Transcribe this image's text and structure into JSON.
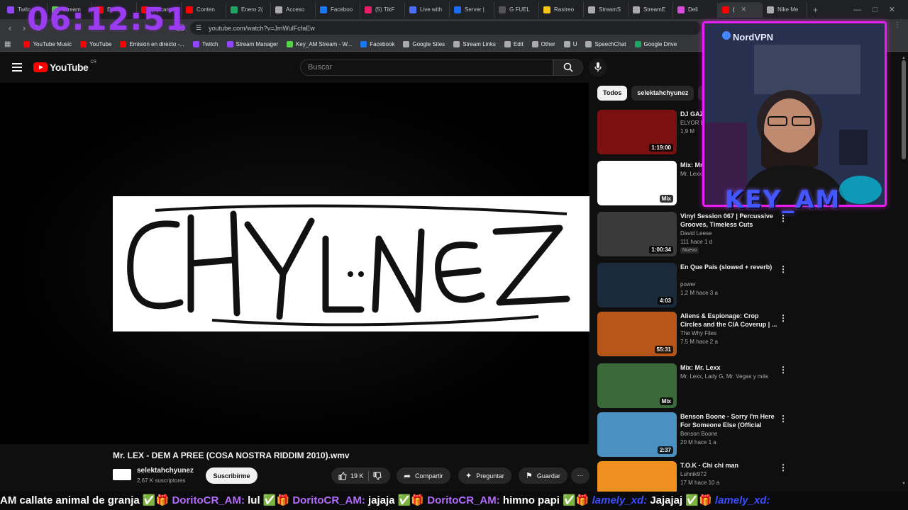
{
  "clock": "06:12:51",
  "browser": {
    "tabs": [
      {
        "label": "Twitc",
        "color": "#9146ff"
      },
      {
        "label": "Stream",
        "color": "#54d24a"
      },
      {
        "label": "Emis",
        "color": "#ff0000"
      },
      {
        "label": "(3) carg",
        "color": "#ff0000"
      },
      {
        "label": "Conten",
        "color": "#ff0000"
      },
      {
        "label": "Enero 2(",
        "color": "#1fa463"
      },
      {
        "label": "Acceso",
        "color": "#aaaaaa"
      },
      {
        "label": "Faceboo",
        "color": "#1877f2"
      },
      {
        "label": "(5) TikF",
        "color": "#e91e63"
      },
      {
        "label": "Live with",
        "color": "#4a6cf7"
      },
      {
        "label": "Server |",
        "color": "#1b6ef3"
      },
      {
        "label": "G FUEL",
        "color": "#555555"
      },
      {
        "label": "Rastreo",
        "color": "#f5c518"
      },
      {
        "label": "StreamS",
        "color": "#aaaaaa"
      },
      {
        "label": "StreamE",
        "color": "#aaaaaa"
      },
      {
        "label": "Deli",
        "color": "#d64fd8"
      },
      {
        "label": "(",
        "color": "#ff0000"
      },
      {
        "label": "Nike Me",
        "color": "#aaaaaa"
      }
    ],
    "url": "youtube.com/watch?v=JmWulFcfaEw",
    "bookmarks": [
      {
        "label": "YouTube Music",
        "color": "#ff0000"
      },
      {
        "label": "YouTube",
        "color": "#ff0000"
      },
      {
        "label": "Emisión en directo -...",
        "color": "#ff0000"
      },
      {
        "label": "Twitch",
        "color": "#9146ff"
      },
      {
        "label": "Stream Manager",
        "color": "#9146ff"
      },
      {
        "label": "Key_AM Stream - W...",
        "color": "#54d24a"
      },
      {
        "label": "Facebook",
        "color": "#1877f2"
      },
      {
        "label": "Google Sites",
        "color": "#aaaaaa"
      },
      {
        "label": "Stream Links",
        "color": "#aaaaaa"
      },
      {
        "label": "Edit",
        "color": "#aaaaaa"
      },
      {
        "label": "Other",
        "color": "#aaaaaa"
      },
      {
        "label": "U",
        "color": "#aaaaaa"
      },
      {
        "label": "SpeechChat",
        "color": "#aaaaaa"
      },
      {
        "label": "Google Drive",
        "color": "#1fa463"
      }
    ]
  },
  "youtube": {
    "logo_text": "YouTube",
    "country": "CR",
    "search_placeholder": "Buscar",
    "video": {
      "title": "Mr. LEX - DEM A PREE (COSA NOSTRA RIDDIM 2010).wmv",
      "channel": "selektahchyunez",
      "subscribers": "2,67 K suscriptores",
      "subscribe_label": "Suscribirme",
      "likes": "19 K",
      "share_label": "Compartir",
      "ask_label": "Preguntar",
      "save_label": "Guardar",
      "art_text": "CHYUNEZ"
    },
    "chips": [
      "Todos",
      "selektahchyunez",
      "F"
    ],
    "recommendations": [
      {
        "title": "DJ GAZ VOL 2 S",
        "channel": "ELYOR E",
        "meta": "1,9 M",
        "duration": "1:19:00",
        "bg": "#7a1010"
      },
      {
        "title": "Mix: Mr (COSA N",
        "channel": "Mr. Lexx,",
        "meta": "",
        "duration": "Mix",
        "bg": "#ffffff"
      },
      {
        "title": "Vinyl Session 067 | Percussive Grooves, Timeless Cuts",
        "channel": "David Leese",
        "meta": "111  hace 1 d",
        "duration": "1:00:34",
        "badge": "Nuevo",
        "bg": "#3a3a3a"
      },
      {
        "title": "En Que País (slowed + reverb)",
        "channel": "power",
        "meta": "1,2 M  hace 3 a",
        "duration": "4:03",
        "bg": "#1a2a3a"
      },
      {
        "title": "Aliens & Espionage: Crop Circles and the CIA Coverup | ...",
        "channel": "The Why Files",
        "meta": "7,5 M  hace 2 a",
        "duration": "55:31",
        "bg": "#b8561a"
      },
      {
        "title": "Mix: Mr. Lexx",
        "channel": "Mr. Lexx, Lady G, Mr. Vegas y más",
        "meta": "",
        "duration": "Mix",
        "bg": "#3a6a3a"
      },
      {
        "title": "Benson Boone - Sorry I'm Here For Someone Else (Official Lyri...",
        "channel": "Benson Boone",
        "meta": "20 M  hace 1 a",
        "duration": "2:37",
        "bg": "#4a90c0"
      },
      {
        "title": "T.O.K - Chi chi man",
        "channel": "Luhnik972",
        "meta": "17 M  hace 10 a",
        "duration": "",
        "bg": "#f09020"
      }
    ]
  },
  "stream": {
    "webcam_sponsor": "NordVPN",
    "streamer_name": "KEY_AM",
    "chat": [
      {
        "user": "",
        "text": "AM callate animal de granja"
      },
      {
        "user": "DoritoCR_AM:",
        "text": "lul"
      },
      {
        "user": "DoritoCR_AM:",
        "text": "jajaja"
      },
      {
        "user": "DoritoCR_AM:",
        "text": "himno papi"
      },
      {
        "user": "lamely_xd:",
        "text": "Jajajaj"
      },
      {
        "user": "lamely_xd:",
        "text": ""
      }
    ]
  }
}
